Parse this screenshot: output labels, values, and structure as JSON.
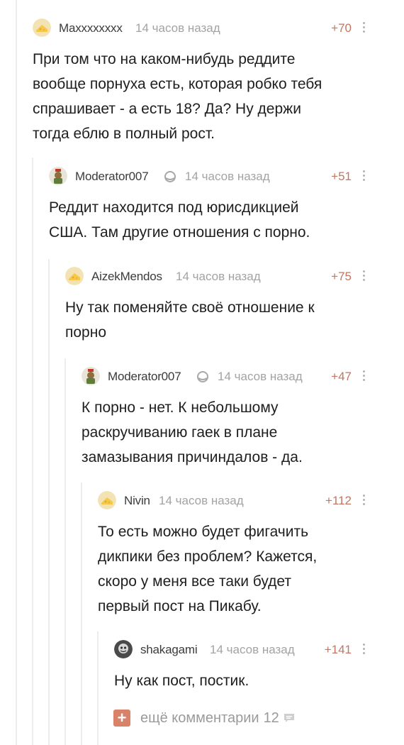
{
  "comments": [
    {
      "username": "Maxxxxxxxx",
      "time": "14 часов назад",
      "rating": "+70",
      "text": "При том что на каком-нибудь реддите\nвообще порнуха есть, которая робко тебя\nспрашивает - а есть 18? Да? Ну держи\nтогда еблю в полный рост.",
      "moderator": false
    },
    {
      "username": "Moderator007",
      "time": "14 часов назад",
      "rating": "+51",
      "text": "Реддит находится под юрисдикцией\nСША. Там другие отношения с порно.",
      "moderator": true
    },
    {
      "username": "AizekMendos",
      "time": "14 часов назад",
      "rating": "+75",
      "text": "Ну так поменяйте своё отношение к\nпорно",
      "moderator": false
    },
    {
      "username": "Moderator007",
      "time": "14 часов назад",
      "rating": "+47",
      "text": "К порно - нет. К небольшому\nраскручиванию гаек в плане\nзамазывания причиндалов - да.",
      "moderator": true
    },
    {
      "username": "Nivin",
      "time": "14 часов назад",
      "rating": "+112",
      "text": "То есть можно будет фигачить\nдикпики без проблем? Кажется,\nскоро у меня все таки будет\nпервый пост на Пикабу.",
      "moderator": false
    },
    {
      "username": "shakagami",
      "time": "14 часов назад",
      "rating": "+141",
      "text": "Ну как пост, постик.",
      "moderator": false
    }
  ],
  "more_comments": {
    "label": "ещё комментарии",
    "count": "12",
    "plus": "+"
  },
  "colors": {
    "rating": "#c07764",
    "meta": "#a3a3a3",
    "accent": "#d9826a"
  },
  "icons": {
    "avatar_default": "cheese-avatar-icon",
    "moderator": "moderator-badge-icon",
    "more": "more-dots-icon",
    "comment": "comment-bubble-icon"
  }
}
